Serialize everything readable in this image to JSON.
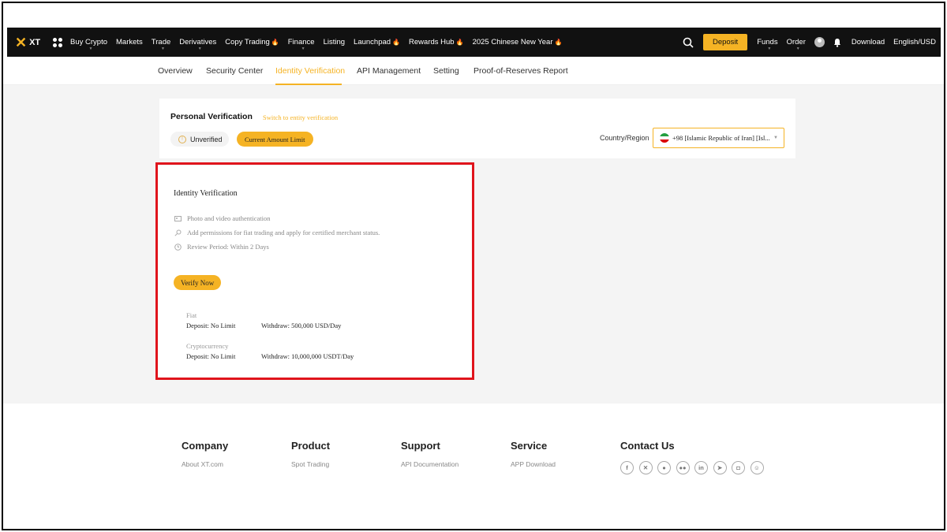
{
  "brand": {
    "name": "XT",
    "accent": "#f5b324"
  },
  "topnav": {
    "items": [
      {
        "label": "Buy Crypto",
        "hot": false
      },
      {
        "label": "Markets",
        "hot": false
      },
      {
        "label": "Trade",
        "hot": false
      },
      {
        "label": "Derivatives",
        "hot": false
      },
      {
        "label": "Copy Trading",
        "hot": true
      },
      {
        "label": "Finance",
        "hot": false
      },
      {
        "label": "Listing",
        "hot": false
      },
      {
        "label": "Launchpad",
        "hot": true
      },
      {
        "label": "Rewards Hub",
        "hot": true
      },
      {
        "label": "2025 Chinese New Year",
        "hot": true
      }
    ],
    "deposit_label": "Deposit",
    "funds_label": "Funds",
    "order_label": "Order",
    "download_label": "Download",
    "lang_label": "English/USD"
  },
  "subnav": {
    "items": [
      "Overview",
      "Security Center",
      "Identity Verification",
      "API Management",
      "Setting",
      "Proof-of-Reserves Report"
    ],
    "active": "Identity Verification"
  },
  "personal": {
    "title": "Personal Verification",
    "switch_link": "Switch to entity verification",
    "status": "Unverified",
    "limit_button": "Current Amount Limit",
    "country_label": "Country/Region",
    "country_value": "+98 [Islamic Republic of Iran] [Isl..."
  },
  "identity": {
    "title": "Identity Verification",
    "features": [
      {
        "icon": "id-card-icon",
        "text": "Photo and video authentication"
      },
      {
        "icon": "key-icon",
        "text": "Add permissions for fiat trading and apply for certified merchant status."
      },
      {
        "icon": "clock-icon",
        "text": "Review Period: Within 2 Days"
      }
    ],
    "verify_button": "Verify Now",
    "fiat": {
      "label": "Fiat",
      "deposit": "Deposit: No Limit",
      "withdraw": "Withdraw: 500,000 USD/Day"
    },
    "crypto": {
      "label": "Cryptocurrency",
      "deposit": "Deposit: No Limit",
      "withdraw": "Withdraw: 10,000,000 USDT/Day"
    }
  },
  "footer": {
    "company": {
      "head": "Company",
      "link": "About XT.com"
    },
    "product": {
      "head": "Product",
      "link": "Spot Trading"
    },
    "support": {
      "head": "Support",
      "link": "API Documentation"
    },
    "service": {
      "head": "Service",
      "link": "APP Download"
    },
    "contact": {
      "head": "Contact Us",
      "socials": [
        "facebook-icon",
        "x-icon",
        "reddit-icon",
        "medium-icon",
        "linkedin-icon",
        "telegram-icon",
        "instagram-icon",
        "discord-icon"
      ]
    }
  }
}
